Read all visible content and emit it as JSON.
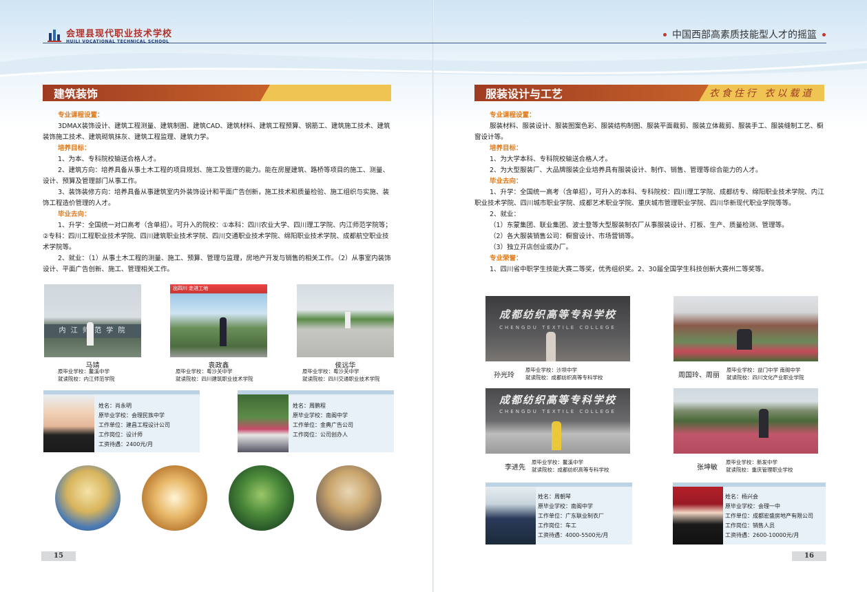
{
  "header": {
    "school_cn": "会理县现代职业技术学校",
    "school_en": "HUILI VOCATIONAL TECHNICAL SCHOOL",
    "slogan": "中国西部高素质技能型人才的摇篮"
  },
  "left": {
    "title": "建筑装饰",
    "h1": "专业课程设置：",
    "courses": "3DMAX装饰设计、建筑工程测量、建筑制图、建筑CAD、建筑材料、建筑工程预算、钢筋工、建筑施工技术、建筑装饰施工技术、建筑砌筑抹灰、建筑工程监理、建筑力学。",
    "h2": "培养目标：",
    "g1": "1、为本、专科院校输送合格人才。",
    "g2": "2、建筑方向：培养具备从事土木工程的项目规划、施工及管理的能力。能在房屋建筑、路桥等项目的施工、测量、设计、预算及管理部门从事工作。",
    "g3": "3、装饰装修方向：培养具备从事建筑室内外装饰设计和平面广告创新，施工技术和质量检验、施工组织与实施、装饰工程造价管理的人才。",
    "h3": "毕业去向：",
    "d1": "1、升学：全国统一对口高考（含单招）。可升入的院校：①本科：四川农业大学、四川理工学院、内江师范学院等；②专科：四川工程职业技术学院、四川建筑职业技术学院、四川交通职业技术学院、绵阳职业技术学院、成都航空职业技术学院等。",
    "d2": "2、就业：（1）从事土木工程的测量、施工、预算、管理与监理，房地产开发与销售的相关工作。（2）从事室内装饰设计、平面广告创新、施工、管理相关工作。",
    "students": [
      {
        "name": "马靖",
        "school": "原毕业学校：鳌溪中学",
        "college": "就读院校：内江师范学院",
        "photo_text": "内 江 师 范 学 院"
      },
      {
        "name": "袁政鑫",
        "school": "原毕业学校：粤沙关中学",
        "college": "就读院校：四川建筑职业技术学院",
        "photo_text": "出四川  走进工地"
      },
      {
        "name": "侯远华",
        "school": "原毕业学校：粤沙关中学",
        "college": "就读院校：四川交通职业技术学院",
        "photo_text": ""
      }
    ],
    "cards": [
      {
        "name": "姓名：肖永明",
        "school": "原毕业学校：会理民族中学",
        "unit": "工作单位：建昌工程设计公司",
        "post": "工作岗位：设计师",
        "pay": "工资待遇：2400元/月"
      },
      {
        "name": "姓名：周鹏程",
        "school": "原毕业学校：南阁中学",
        "unit": "工作单位：金典广告公司",
        "post": "工作岗位：公司创办人",
        "pay": ""
      }
    ],
    "page": "15"
  },
  "right": {
    "title": "服装设计与工艺",
    "motto": "衣食住行 衣以载道",
    "h1": "专业课程设置：",
    "courses": "服装材料、服装设计、服装图案色彩、服装结构制图、服装平面裁剪、服装立体裁剪、服装手工、服装缝制工艺、橱窗设计等。",
    "h2": "培养目标：",
    "g1": "1、为大学本科、专科院校输送合格人才。",
    "g2": "2、为大型服装厂、大品牌服装企业培养具有服装设计、制作、销售、管理等综合能力的人才。",
    "h3": "毕业去向：",
    "d1": "1、升学：全国统一高考（含单招），可升入的本科、专科院校：四川理工学院、成都纺专、绵阳职业技术学院、内江职业技术学院、四川城市职业学院、成都艺术职业学院、重庆城市管理职业学院、四川华新现代职业学院等等。",
    "d2": "2、就业：",
    "d2a": "（1）东蒙集团、联业集团、波士登等大型服装制衣厂从事服装设计、打板、生产、质量检测、管理等。",
    "d2b": "（2）各大服装销售公司：橱窗设计、市场营销等。",
    "d2c": "（3）独立开店创业或办厂。",
    "h4": "专业荣誉：",
    "honor": "1、四川省中职学生技能大赛二等奖，优秀组织奖。2、30届全国学生科技创新大赛州二等奖等。",
    "students": [
      {
        "name": "孙光玲",
        "school": "原毕业学校：沙坝中学",
        "college": "就读院校：成都纺织高等专科学校",
        "photo_text": "成都纺织高等专科学校",
        "photo_en": "CHENGDU TEXTILE COLLEGE"
      },
      {
        "name": "周国玲、周丽",
        "school": "原毕业学校：益门中学  南阁中学",
        "college": "就读院校：四川文化产业职业学院",
        "photo_text": "",
        "photo_en": ""
      },
      {
        "name": "李进先",
        "school": "原毕业学校：鳌溪中学",
        "college": "就读院校：成都纺织高等专科学校",
        "photo_text": "成都纺织高等专科学校",
        "photo_en": "CHENGDU TEXTILE COLLEGE"
      },
      {
        "name": "张坤敏",
        "school": "原毕业学校：新发中学",
        "college": "就读院校：重庆管理职业学校",
        "photo_text": "",
        "photo_en": ""
      }
    ],
    "cards": [
      {
        "name": "姓名：周朝琴",
        "school": "原毕业学校：南阁中学",
        "unit": "工作单位：广东联业制衣厂",
        "post": "工作岗位：车工",
        "pay": "工资待遇：4000-5500元/月"
      },
      {
        "name": "姓名：杨兴会",
        "school": "原毕业学校：会理一中",
        "unit": "工作单位：成都宏盛房地产有限公司",
        "post": "工作岗位：销售人员",
        "pay": "工资待遇：2600-10000元/月"
      }
    ],
    "page": "16"
  }
}
